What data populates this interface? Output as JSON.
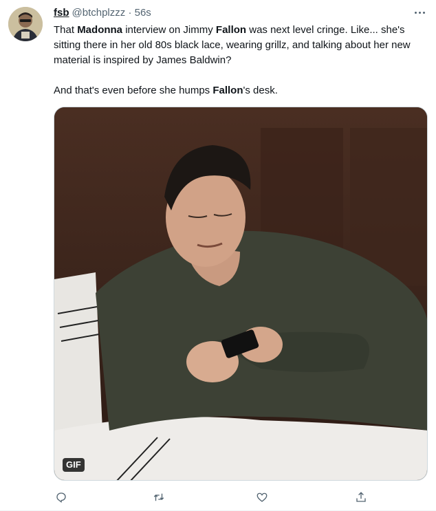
{
  "tweet": {
    "author_name": "fsb",
    "handle": "@btchplzzz",
    "separator": "·",
    "time": "56s",
    "paragraph1": [
      {
        "text": "That ",
        "bold": false
      },
      {
        "text": "Madonna",
        "bold": true
      },
      {
        "text": " interview on Jimmy ",
        "bold": false
      },
      {
        "text": "Fallon",
        "bold": true
      },
      {
        "text": " was next level cringe. Like... she's sitting there in her old 80s black lace, wearing grillz, and talking about her new material is inspired by James Baldwin?",
        "bold": false
      }
    ],
    "paragraph2": [
      {
        "text": "And that's even before she humps ",
        "bold": false
      },
      {
        "text": "Fallon",
        "bold": true
      },
      {
        "text": "'s desk.",
        "bold": false
      }
    ],
    "media_badge": "GIF"
  },
  "actions": [
    {
      "name": "reply",
      "icon": "reply-icon"
    },
    {
      "name": "retweet",
      "icon": "retweet-icon"
    },
    {
      "name": "like",
      "icon": "heart-icon"
    },
    {
      "name": "share",
      "icon": "share-icon"
    }
  ],
  "colors": {
    "text_primary": "#0f1419",
    "text_secondary": "#536471",
    "border": "#cfd9de"
  }
}
